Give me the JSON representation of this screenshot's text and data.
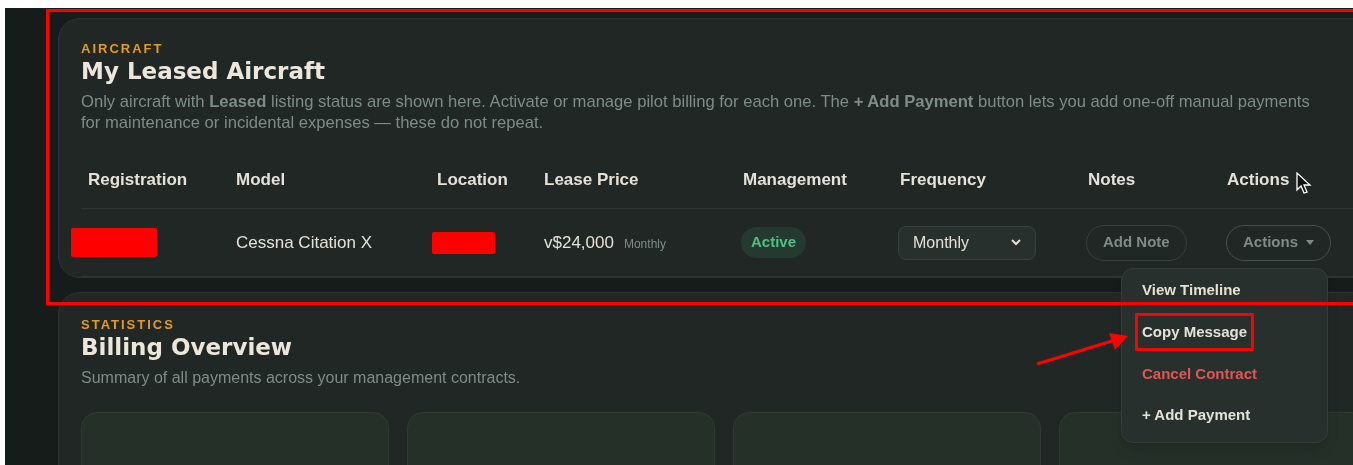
{
  "aircraft_section": {
    "eyebrow": "AIRCRAFT",
    "title": "My Leased Aircraft",
    "description": "Only aircraft with **Leased** listing status are shown here. Activate or manage pilot billing for each one. The **+ Add Payment** button lets you add one-off manual payments for maintenance or incidental expenses — these do not repeat.",
    "table": {
      "columns": [
        "Registration",
        "Model",
        "Location",
        "Lease Price",
        "Management",
        "Frequency",
        "Notes",
        "Actions"
      ],
      "rows": [
        {
          "model": "Cessna Citation X",
          "price": "v$24,000",
          "price_period": "Monthly",
          "management": "Active",
          "frequency": "Monthly",
          "notes_button": "Add Note",
          "actions_button": "Actions",
          "menu_open": true
        }
      ]
    }
  },
  "actions_menu": {
    "items": [
      {
        "label": "View Timeline",
        "kind": "normal",
        "highlighted": false
      },
      {
        "label": "Copy Message",
        "kind": "normal",
        "highlighted": true
      },
      {
        "label": "Cancel Contract",
        "kind": "danger",
        "highlighted": false
      },
      {
        "label": "+ Add Payment",
        "kind": "normal",
        "highlighted": false
      }
    ]
  },
  "statistics_section": {
    "eyebrow": "STATISTICS",
    "title": "Billing Overview",
    "description": "Summary of all payments across your management contracts.",
    "stat_cards": [
      {
        "kind": "empty"
      },
      {
        "kind": "empty"
      },
      {
        "kind": "empty"
      },
      {
        "kind": "empty"
      }
    ]
  }
}
